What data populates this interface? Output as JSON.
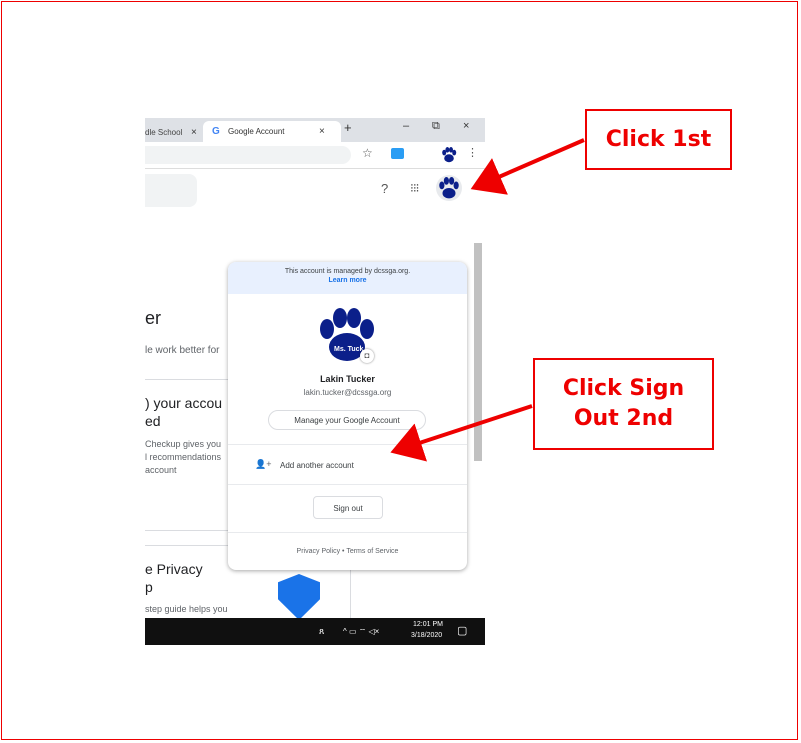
{
  "browser": {
    "tabs": [
      {
        "label": "dle School"
      },
      {
        "label": "Google Account"
      }
    ],
    "tab_close": "×",
    "g_icon": "G",
    "new_tab": "+",
    "window": {
      "minimize": "–",
      "restore": "⧉",
      "close": "×"
    },
    "star": "☆",
    "kebab": "⋮"
  },
  "page": {
    "help_icon": "?",
    "apps_icon": "⁝⁝⁝",
    "heading_fragment": "er",
    "sub_fragment": "le work better for",
    "card1_title": ") your accou",
    "card1_title2": "ed",
    "card1_body1": "Checkup gives you",
    "card1_body2": "l recommendations",
    "card1_body3": "account",
    "card2_title": "e Privacy",
    "card2_title2": "p",
    "card2_body": "step guide helps you"
  },
  "popup": {
    "managed_text": "This account is managed by dcssga.org.",
    "learn_more": "Learn more",
    "avatar_label": "Ms. Tuck",
    "camera_icon": "◘",
    "name": "Lakin Tucker",
    "email": "lakin.tucker@dcssga.org",
    "manage_button": "Manage your Google Account",
    "add_account_icon": "👤+",
    "add_account": "Add another account",
    "sign_out": "Sign out",
    "footer": "Privacy Policy  •  Terms of Service"
  },
  "taskbar": {
    "people_icon": "ጸ",
    "tray": "^ ▭ ⌔ ◁×",
    "time": "12:01 PM",
    "date": "3/18/2020",
    "notif_icon": "▢"
  },
  "annotations": {
    "click_first": "Click 1st",
    "click_signout_line1": "Click Sign",
    "click_signout_line2": "Out 2nd"
  },
  "colors": {
    "annotation_red": "#e00000",
    "paw_navy": "#0b1f8a",
    "link_blue": "#1a73e8"
  }
}
